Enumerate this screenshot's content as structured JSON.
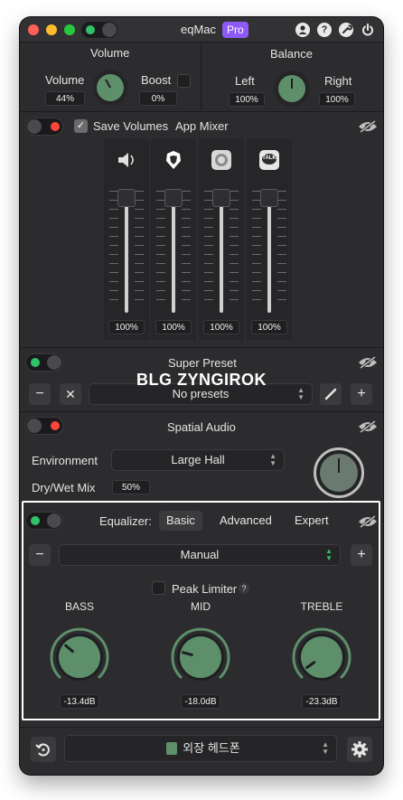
{
  "app": {
    "title": "eqMac",
    "badge": "Pro"
  },
  "volume_section": {
    "heading": "Volume",
    "volume_label": "Volume",
    "volume_value": "44%",
    "boost_label": "Boost",
    "boost_value": "0%"
  },
  "balance_section": {
    "heading": "Balance",
    "left_label": "Left",
    "left_value": "100%",
    "right_label": "Right",
    "right_value": "100%"
  },
  "mixer": {
    "save_volumes_label": "Save Volumes",
    "title": "App Mixer",
    "apps": [
      {
        "icon": "speaker-icon",
        "value": "100%",
        "level": 1.0
      },
      {
        "icon": "brave-icon",
        "value": "100%",
        "level": 1.0
      },
      {
        "icon": "chrome-icon",
        "value": "100%",
        "level": 1.0
      },
      {
        "icon": "talk-icon",
        "icon_text": "TALK",
        "value": "100%",
        "level": 1.0
      }
    ]
  },
  "super_preset": {
    "title": "Super Preset",
    "preset_value": "No presets"
  },
  "overlay_text": "BLG ZYNGIROK",
  "spatial_audio": {
    "title": "Spatial Audio",
    "environment_label": "Environment",
    "environment_value": "Large Hall",
    "drywet_label": "Dry/Wet Mix",
    "drywet_value": "50%"
  },
  "equalizer": {
    "label": "Equalizer:",
    "tabs": [
      "Basic",
      "Advanced",
      "Expert"
    ],
    "active_tab": "Basic",
    "preset_value": "Manual",
    "peak_limiter_label": "Peak Limiter",
    "help_symbol": "?",
    "bands": [
      {
        "label": "BASS",
        "value": "-13.4dB"
      },
      {
        "label": "MID",
        "value": "-18.0dB"
      },
      {
        "label": "TREBLE",
        "value": "-23.3dB"
      }
    ]
  },
  "footer": {
    "device_value": "외장 헤드폰"
  },
  "colors": {
    "accent_green": "#5e8f6b",
    "pro_purple": "#8e5af7",
    "toggle_on": "#30c267",
    "toggle_off": "#ff453a"
  }
}
